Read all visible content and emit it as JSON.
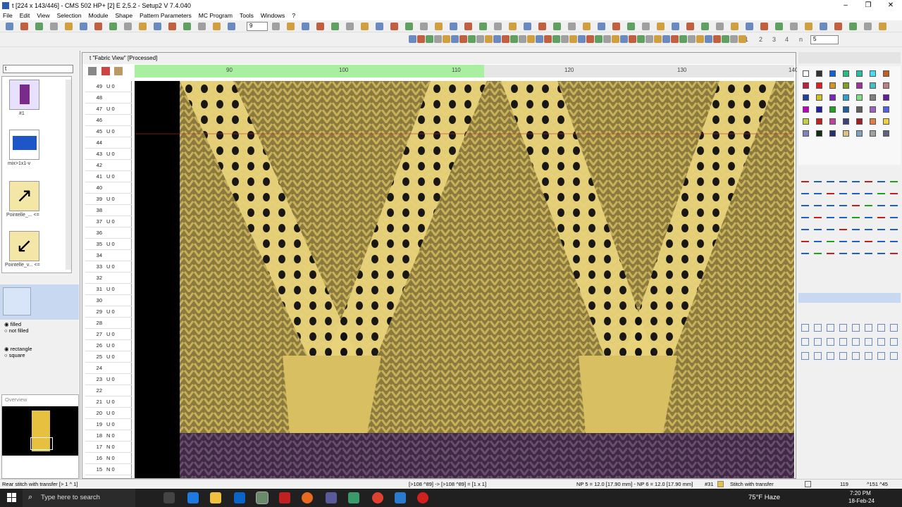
{
  "window": {
    "title": "t [224 x 143/446] - CMS 502 HP+ [2] E 2,5.2 - Setup2   V 7.4.040"
  },
  "menu": [
    "File",
    "Edit",
    "View",
    "Selection",
    "Module",
    "Shape",
    "Pattern Parameters",
    "MC Program",
    "Tools",
    "Windows",
    "?"
  ],
  "toolbar": {
    "zoom_value": "9",
    "right_numbers": [
      "1",
      "2",
      "3",
      "4",
      "n",
      "5"
    ]
  },
  "left_panel": {
    "dropdown_value": "t",
    "items": [
      {
        "label": "#1"
      },
      {
        "label": "mix>1x1-v"
      },
      {
        "label": "Pointelle_...\n<="
      },
      {
        "label": "Pointelle_v...\n<="
      }
    ],
    "fill_options": [
      "filled",
      "not filled"
    ],
    "shape_options": [
      "rectangle",
      "square"
    ],
    "overview_label": "Overview"
  },
  "fabric_view": {
    "title": "t \"Fabric View\" [Processed]",
    "ruler_ticks": [
      "90",
      "100",
      "110",
      "120",
      "130",
      "140"
    ],
    "rows": [
      {
        "n": "49",
        "c": "U 0"
      },
      {
        "n": "48",
        "c": ""
      },
      {
        "n": "47",
        "c": "U 0"
      },
      {
        "n": "46",
        "c": ""
      },
      {
        "n": "45",
        "c": "U 0"
      },
      {
        "n": "44",
        "c": ""
      },
      {
        "n": "43",
        "c": "U 0"
      },
      {
        "n": "42",
        "c": ""
      },
      {
        "n": "41",
        "c": "U 0"
      },
      {
        "n": "40",
        "c": ""
      },
      {
        "n": "39",
        "c": "U 0"
      },
      {
        "n": "38",
        "c": ""
      },
      {
        "n": "37",
        "c": "U 0"
      },
      {
        "n": "36",
        "c": ""
      },
      {
        "n": "35",
        "c": "U 0"
      },
      {
        "n": "34",
        "c": ""
      },
      {
        "n": "33",
        "c": "U 0"
      },
      {
        "n": "32",
        "c": ""
      },
      {
        "n": "31",
        "c": "U 0"
      },
      {
        "n": "30",
        "c": ""
      },
      {
        "n": "29",
        "c": "U 0"
      },
      {
        "n": "28",
        "c": ""
      },
      {
        "n": "27",
        "c": "U 0"
      },
      {
        "n": "26",
        "c": "U 0"
      },
      {
        "n": "25",
        "c": "U 0"
      },
      {
        "n": "24",
        "c": ""
      },
      {
        "n": "23",
        "c": "U 0"
      },
      {
        "n": "22",
        "c": ""
      },
      {
        "n": "21",
        "c": "U 0"
      },
      {
        "n": "20",
        "c": "U 0"
      },
      {
        "n": "19",
        "c": "U 0"
      },
      {
        "n": "18",
        "c": "N 0"
      },
      {
        "n": "17",
        "c": "N 0"
      },
      {
        "n": "16",
        "c": "N 0"
      },
      {
        "n": "15",
        "c": "N 0"
      }
    ]
  },
  "status": {
    "left": "Rear stitch with transfer [> 1 ^ 1]",
    "pos": "[>108 ^89] -> [>108 ^89] = [1 x 1]",
    "np": "NP 5 = 12.0 [17.90 mm] - NP 6 = 12.0 [17.90 mm]",
    "system": "#31",
    "stitch": "Stitch with transfer",
    "col": "119",
    "coord": "^151 ^45"
  },
  "taskbar": {
    "search_placeholder": "Type here to search",
    "weather": "75°F  Haze",
    "time": "7:20 PM",
    "date": "18-Feb-24"
  },
  "colors": {
    "yarn_gold": "#c9b15a",
    "yarn_bright": "#f2e08a",
    "purple": "#5a3e5f",
    "ruler_green": "#a8f0a0"
  }
}
